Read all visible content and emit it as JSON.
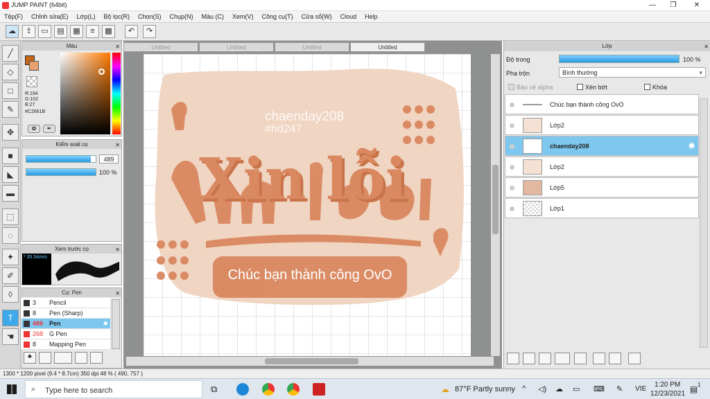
{
  "window": {
    "title": "JUMP PAINT (64bit)",
    "minimize": "—",
    "maximize": "❐",
    "close": "✕"
  },
  "menu": [
    "Tệp(F)",
    "Chỉnh sửa(E)",
    "Lớp(L)",
    "Bộ lọc(R)",
    "Chọn(S)",
    "Chụp(N)",
    "Màu (C)",
    "Xem(V)",
    "Công cụ(T)",
    "Cửa sổ(W)",
    "Cloud",
    "Help"
  ],
  "tabs": [
    "Untitled",
    "Untitled",
    "Untitled",
    "Untitled"
  ],
  "color_panel": {
    "title": "Màu",
    "r": "R:194",
    "g": "G:102",
    "b": "B:27",
    "hex": "#C2661B",
    "main_color": "#C2661B"
  },
  "brush_control": {
    "title": "Kiểm soát cọ",
    "size": "489",
    "opacity": "100 %",
    "size_level": 0.93,
    "opacity_level": 1.0
  },
  "preview": {
    "title": "Xem trước cọ",
    "size_text": "* 35.54mm"
  },
  "brushes": {
    "title": "Cọ: Pen",
    "items": [
      {
        "size": "3",
        "name": "Pencil",
        "color": "#333333"
      },
      {
        "size": "8",
        "name": "Pen (Sharp)",
        "color": "#333333"
      },
      {
        "size": "489",
        "name": "Pen",
        "color": "#333333"
      },
      {
        "size": "268",
        "name": "G Pen",
        "color": "#e03a3a"
      },
      {
        "size": "8",
        "name": "Mapping Pen",
        "color": "#e03a3a"
      }
    ]
  },
  "canvas": {
    "watermark1": "chaenday208",
    "watermark2": "#hd247",
    "headline": "Xin lỗi",
    "banner": "Chúc bạn thành công OvO",
    "bg_color": "#f0d5c2",
    "art_color": "#d98860"
  },
  "layer_panel": {
    "title": "Lớp",
    "opacity_label": "Độ trong",
    "opacity_value": "100 %",
    "opacity_level": 1.0,
    "blend_label": "Pha trộn",
    "blend_value": "Bình thường",
    "protect_alpha": "Bảo vệ alpha",
    "clip": "Xén bớt",
    "lock": "Khóa",
    "layers": [
      {
        "name": "Chúc bạn thành công OvO",
        "selected": false
      },
      {
        "name": "Lớp2",
        "selected": false
      },
      {
        "name": "chaenday208",
        "selected": true
      },
      {
        "name": "Lớp2",
        "selected": false
      },
      {
        "name": "Lớp5",
        "selected": false
      },
      {
        "name": "Lớp1",
        "selected": false
      }
    ]
  },
  "status": "1300 * 1200 pixel  (9.4 * 8.7cm)  350 dpi   48 %  ( 490, 757 )",
  "taskbar": {
    "search": "Type here to search",
    "weather": "87°F  Partly sunny",
    "lang": "VIE",
    "time": "1:20 PM",
    "date": "12/23/2021",
    "notif": "1"
  }
}
